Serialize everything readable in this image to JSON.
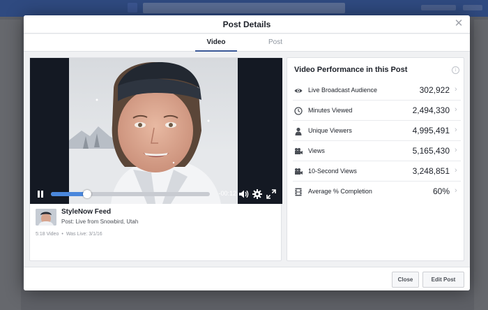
{
  "modal": {
    "title": "Post Details",
    "tabs": [
      {
        "label": "Video",
        "active": true
      },
      {
        "label": "Post",
        "active": false
      }
    ]
  },
  "video": {
    "elapsed_fraction": 0.23,
    "time_remaining": "-00:12",
    "poster": {
      "name": "StyleNow Feed",
      "post_text": "Post: Live from Snowbird, Utah",
      "duration": "5:18 Video",
      "separator": "•",
      "was_live": "Was Live: 3/1/16"
    }
  },
  "performance": {
    "title": "Video Performance in this Post",
    "info_glyph": "i",
    "metrics": [
      {
        "label": "Live Broadcast Audience",
        "value": "302,922",
        "icon": "eye-icon"
      },
      {
        "label": "Minutes Viewed",
        "value": "2,494,330",
        "icon": "clock-icon"
      },
      {
        "label": "Unique Viewers",
        "value": "4,995,491",
        "icon": "person-icon"
      },
      {
        "label": "Views",
        "value": "5,165,430",
        "icon": "video-camera-icon"
      },
      {
        "label": "10-Second Views",
        "value": "3,248,851",
        "icon": "video-camera-icon"
      },
      {
        "label": "Average % Completion",
        "value": "60%",
        "icon": "film-icon"
      }
    ],
    "chevron": "›"
  },
  "footer": {
    "close_label": "Close",
    "edit_label": "Edit Post"
  },
  "colors": {
    "brand": "#3b5998",
    "scrub_fill": "#4a87dc",
    "overlay": "#5e6066"
  }
}
